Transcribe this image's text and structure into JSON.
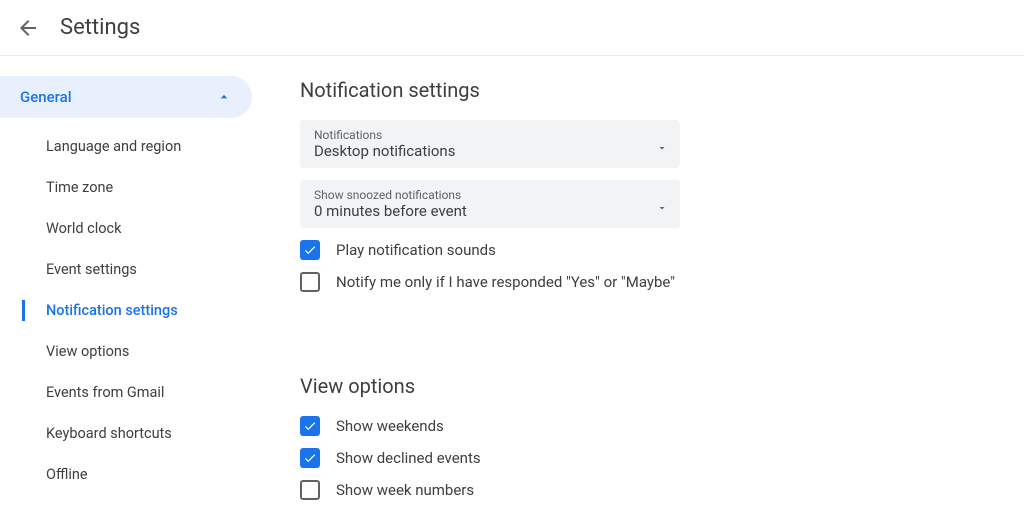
{
  "header": {
    "title": "Settings"
  },
  "sidebar": {
    "section_title": "General",
    "items": [
      {
        "label": "Language and region",
        "active": false
      },
      {
        "label": "Time zone",
        "active": false
      },
      {
        "label": "World clock",
        "active": false
      },
      {
        "label": "Event settings",
        "active": false
      },
      {
        "label": "Notification settings",
        "active": true
      },
      {
        "label": "View options",
        "active": false
      },
      {
        "label": "Events from Gmail",
        "active": false
      },
      {
        "label": "Keyboard shortcuts",
        "active": false
      },
      {
        "label": "Offline",
        "active": false
      }
    ]
  },
  "main": {
    "notification_section": {
      "title": "Notification settings",
      "dropdowns": [
        {
          "label": "Notifications",
          "value": "Desktop notifications"
        },
        {
          "label": "Show snoozed notifications",
          "value": "0 minutes before event"
        }
      ],
      "checkboxes": [
        {
          "label": "Play notification sounds",
          "checked": true
        },
        {
          "label": "Notify me only if I have responded \"Yes\" or \"Maybe\"",
          "checked": false
        }
      ]
    },
    "view_section": {
      "title": "View options",
      "checkboxes": [
        {
          "label": "Show weekends",
          "checked": true
        },
        {
          "label": "Show declined events",
          "checked": true
        },
        {
          "label": "Show week numbers",
          "checked": false
        }
      ]
    }
  }
}
